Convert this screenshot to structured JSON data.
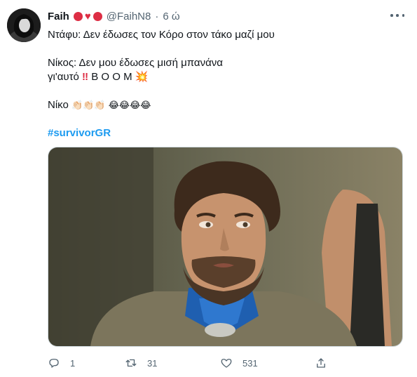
{
  "tweet": {
    "author_name": "Faih",
    "author_handle": "@FaihN8",
    "separator": "·",
    "time": "6 ώ",
    "badges": [
      "red-circle",
      "red-heart",
      "red-circle"
    ],
    "lines": [
      "Ντάφυ: Δεν έδωσες τον Κόρο στον τάκο μαζί μου",
      "Νίκος: Δεν μου έδωσες μισή μπανάνα",
      "γι'αυτό",
      "Β Ο Ο Μ",
      "Νίκο"
    ],
    "emojis": {
      "double_exclamation": "‼",
      "collision": "💥",
      "claps": "👏🏻👏🏻👏🏻",
      "laughs": "😂😂😂😂"
    },
    "hashtag": "#survivorGR",
    "media": {
      "type": "video-still",
      "description_icon": "bearded-man-image"
    },
    "stats": {
      "replies": "1",
      "retweets": "31",
      "likes": "531"
    },
    "colors": {
      "hashtag": "#1d9bf0",
      "secondary_text": "#536471",
      "badge_red": "#dd2e44"
    }
  }
}
